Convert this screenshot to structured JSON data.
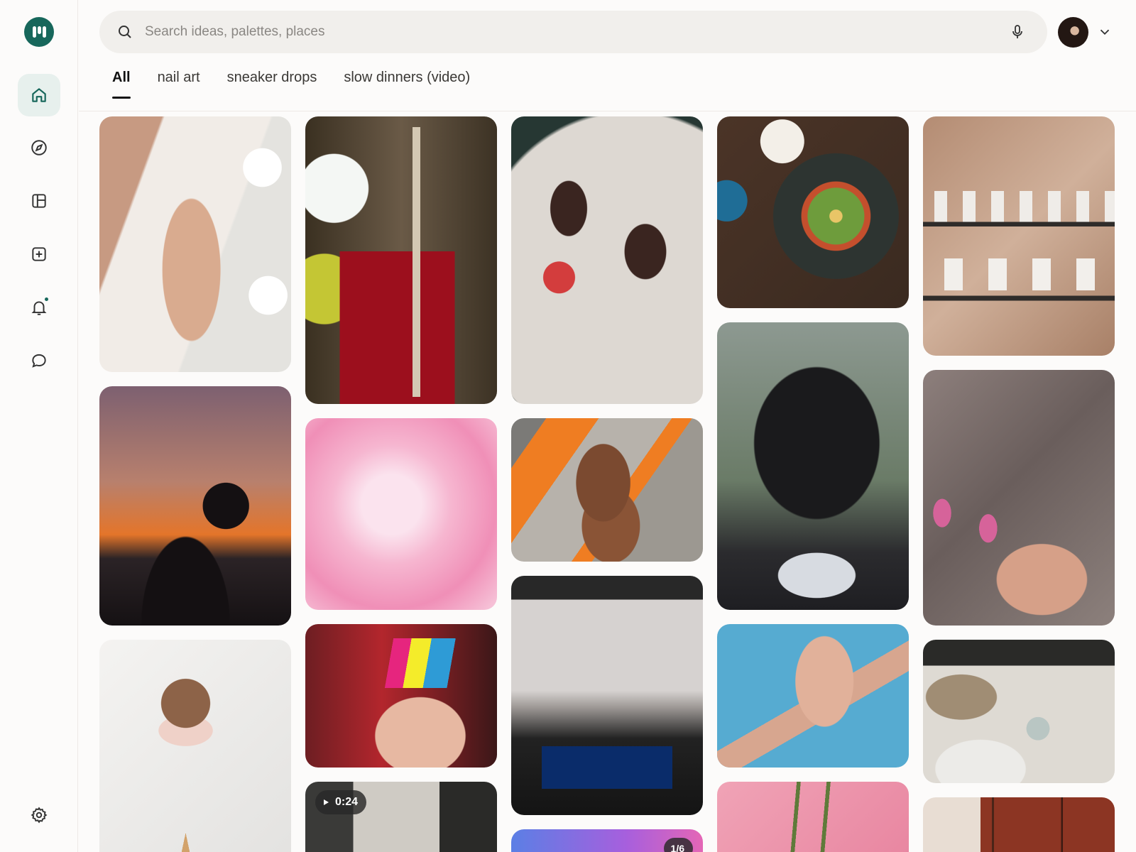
{
  "app": {
    "brand_color": "#17675b"
  },
  "search": {
    "placeholder": "Search ideas, palettes, places"
  },
  "sidebar": {
    "items": [
      {
        "name": "home",
        "icon": "home-icon",
        "active": true
      },
      {
        "name": "explore",
        "icon": "compass-icon",
        "active": false
      },
      {
        "name": "boards",
        "icon": "layout-icon",
        "active": false
      },
      {
        "name": "create",
        "icon": "plus-square-icon",
        "active": false
      },
      {
        "name": "notifications",
        "icon": "bell-icon",
        "active": false,
        "has_dot": true
      },
      {
        "name": "messages",
        "icon": "chat-icon",
        "active": false
      }
    ],
    "settings_icon": "gear-icon"
  },
  "tabs": [
    {
      "label": "All",
      "active": true
    },
    {
      "label": "nail art",
      "active": false
    },
    {
      "label": "sneaker drops",
      "active": false
    },
    {
      "label": "slow dinners (video)",
      "active": false
    }
  ],
  "pins": [
    {
      "id": "c1-1",
      "subject": "hand-with-ring"
    },
    {
      "id": "c1-2",
      "subject": "sunset-silhouette"
    },
    {
      "id": "c1-3",
      "subject": "ice-cream-cone"
    },
    {
      "id": "c2-1",
      "subject": "red-iced-drink"
    },
    {
      "id": "c2-2",
      "subject": "pink-peony"
    },
    {
      "id": "c2-3",
      "subject": "colorful-nails"
    },
    {
      "id": "c2-4",
      "subject": "video-window",
      "video_duration": "0:24"
    },
    {
      "id": "c3-1",
      "subject": "chocolate-strawberries"
    },
    {
      "id": "c3-2",
      "subject": "suede-boots"
    },
    {
      "id": "c3-3",
      "subject": "car-dashboard"
    },
    {
      "id": "c3-4",
      "subject": "gradient-carousel",
      "carousel_count": "1/6"
    },
    {
      "id": "c4-1",
      "subject": "breakfast-plate"
    },
    {
      "id": "c4-2",
      "subject": "braided-hair"
    },
    {
      "id": "c4-3",
      "subject": "hand-blue-background"
    },
    {
      "id": "c4-4",
      "subject": "pink-plant"
    },
    {
      "id": "c5-1",
      "subject": "ceramic-shelves"
    },
    {
      "id": "c5-2",
      "subject": "green-nails-linen"
    },
    {
      "id": "c5-3",
      "subject": "ceramic-plates"
    },
    {
      "id": "c5-4",
      "subject": "incense-sticks"
    }
  ]
}
